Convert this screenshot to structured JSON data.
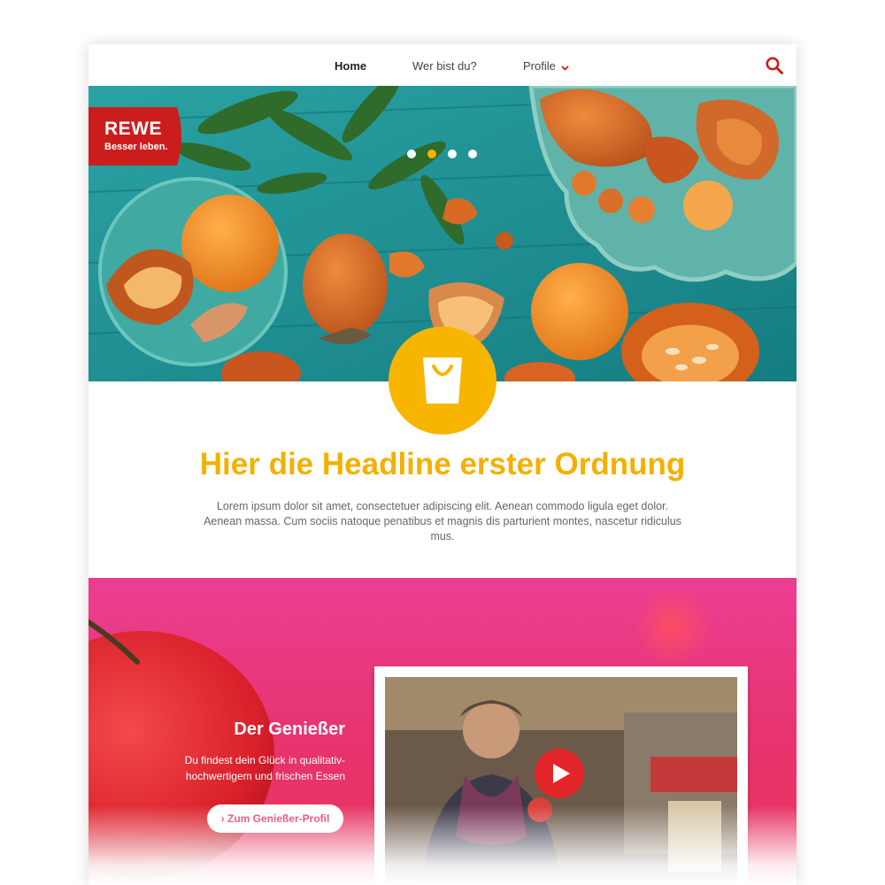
{
  "nav": {
    "items": [
      {
        "label": "Home"
      },
      {
        "label": "Wer bist du?"
      },
      {
        "label": "Profile"
      }
    ]
  },
  "logo": {
    "name": "REWE",
    "tagline": "Besser leben."
  },
  "hero": {
    "slide_count": 4,
    "active_slide": 2
  },
  "intro": {
    "headline": "Hier die Headline erster Ordnung",
    "text": "Lorem ipsum dolor sit amet, consectetuer adipiscing elit. Aenean commodo ligula eget dolor. Aenean massa. Cum sociis natoque penatibus et magnis dis parturient montes, nascetur ridiculus mus."
  },
  "profile_section": {
    "title": "Der Genießer",
    "text": "Du findest dein Glück in qualitativ-hochwertigem und frischen Essen",
    "button_label": "› Zum Genießer-Profil"
  },
  "colors": {
    "brand_red": "#cc1d1d",
    "accent_yellow": "#f4b000",
    "pink": "#e8326a",
    "play_red": "#e3262a"
  },
  "icons": {
    "search": "search-icon",
    "chevron": "chevron-down-icon",
    "shopping_bag": "shopping-bag-icon",
    "play": "play-icon"
  }
}
